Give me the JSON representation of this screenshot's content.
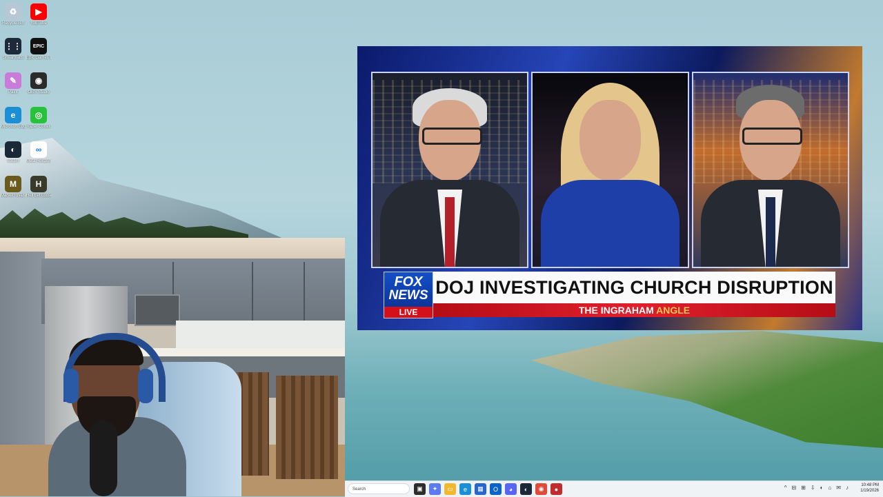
{
  "desktop": {
    "icons": [
      {
        "name": "recycle-bin-icon",
        "label": "Recycle Bin",
        "color": "#b8c7d6",
        "glyph": "♻"
      },
      {
        "name": "youtube-icon",
        "label": "YouTube",
        "color": "#ff0000",
        "glyph": "▶"
      },
      {
        "name": "streamlabs-icon",
        "label": "Streamlabs",
        "color": "#1d2a3a",
        "glyph": "⋮⋮"
      },
      {
        "name": "epic-games-icon",
        "label": "Epic Games Launcher",
        "color": "#111111",
        "glyph": "EPIC"
      },
      {
        "name": "paint-icon",
        "label": "Paint",
        "color": "#c97bd9",
        "glyph": "✎"
      },
      {
        "name": "obs-studio-icon",
        "label": "OBS Studio",
        "color": "#2b2b2b",
        "glyph": "◉"
      },
      {
        "name": "edge-icon",
        "label": "Microsoft Edge",
        "color": "#1b8fd6",
        "glyph": "e"
      },
      {
        "name": "razer-cortex-icon",
        "label": "Razer Cortex",
        "color": "#25c23a",
        "glyph": "◎"
      },
      {
        "name": "steam-icon",
        "label": "Steam",
        "color": "#1b2838",
        "glyph": "◐"
      },
      {
        "name": "meta-icon",
        "label": "Meta Horizon Link",
        "color": "#ffffff",
        "glyph": "∞"
      },
      {
        "name": "marvel-rivals-icon",
        "label": "Marvel Rivals",
        "color": "#6a5a1c",
        "glyph": "M"
      },
      {
        "name": "hell-let-loose-icon",
        "label": "Hell Let Loose",
        "color": "#3a3a2a",
        "glyph": "H"
      }
    ]
  },
  "news": {
    "logo_top": "FOX",
    "logo_bottom": "NEWS",
    "live_label": "LIVE",
    "headline": "DOJ INVESTIGATING CHURCH DISRUPTION",
    "show_prefix": "THE",
    "show_name": "INGRAHAM",
    "show_suffix": "ANGLE"
  },
  "taskbar": {
    "search_placeholder": "Search",
    "apps": [
      {
        "name": "task-view-icon",
        "color": "#2d2d2d",
        "glyph": "▣"
      },
      {
        "name": "copilot-icon",
        "color": "#5a7cf0",
        "glyph": "✦"
      },
      {
        "name": "file-explorer-icon",
        "color": "#f2b830",
        "glyph": "▭"
      },
      {
        "name": "edge-taskbar-icon",
        "color": "#1b8fd6",
        "glyph": "e"
      },
      {
        "name": "store-icon",
        "color": "#2767c9",
        "glyph": "▦"
      },
      {
        "name": "outlook-icon",
        "color": "#0a64c8",
        "glyph": "O"
      },
      {
        "name": "discord-icon",
        "color": "#5865f2",
        "glyph": "◕"
      },
      {
        "name": "steam-taskbar-icon",
        "color": "#1b2838",
        "glyph": "◐"
      },
      {
        "name": "chrome-icon",
        "color": "#e04a3a",
        "glyph": "◉"
      },
      {
        "name": "streaming-app-icon",
        "color": "#c22b2b",
        "glyph": "●"
      }
    ],
    "tray": [
      "^",
      "⊟",
      "⊞",
      "⇩",
      "◐",
      "⌂",
      "✉",
      "♪"
    ],
    "time": "10:48 PM",
    "date": "1/19/2026"
  }
}
